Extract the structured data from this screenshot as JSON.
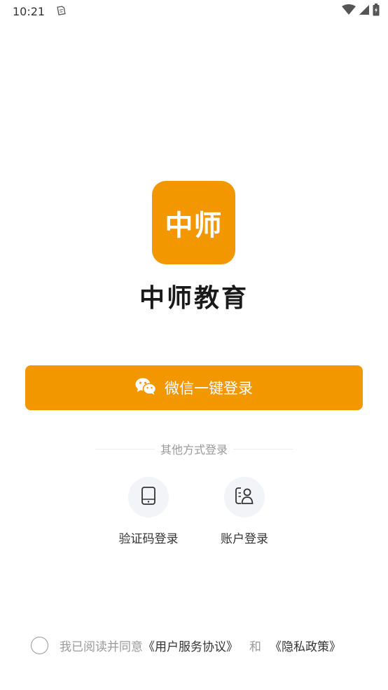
{
  "status_bar": {
    "time": "10:21"
  },
  "app": {
    "logo_text": "中师",
    "name": "中师教育",
    "brand_color": "#f29700"
  },
  "wechat_login": {
    "label": "微信一键登录",
    "icon": "wechat-icon"
  },
  "other_methods": {
    "divider_text": "其他方式登录",
    "options": [
      {
        "label": "验证码登录",
        "icon": "phone-icon"
      },
      {
        "label": "账户登录",
        "icon": "account-card-icon"
      }
    ]
  },
  "agreement": {
    "prefix": "我已阅读并同意",
    "user_agreement": "《用户服务协议》",
    "and": "和",
    "privacy_policy": "《隐私政策》"
  }
}
